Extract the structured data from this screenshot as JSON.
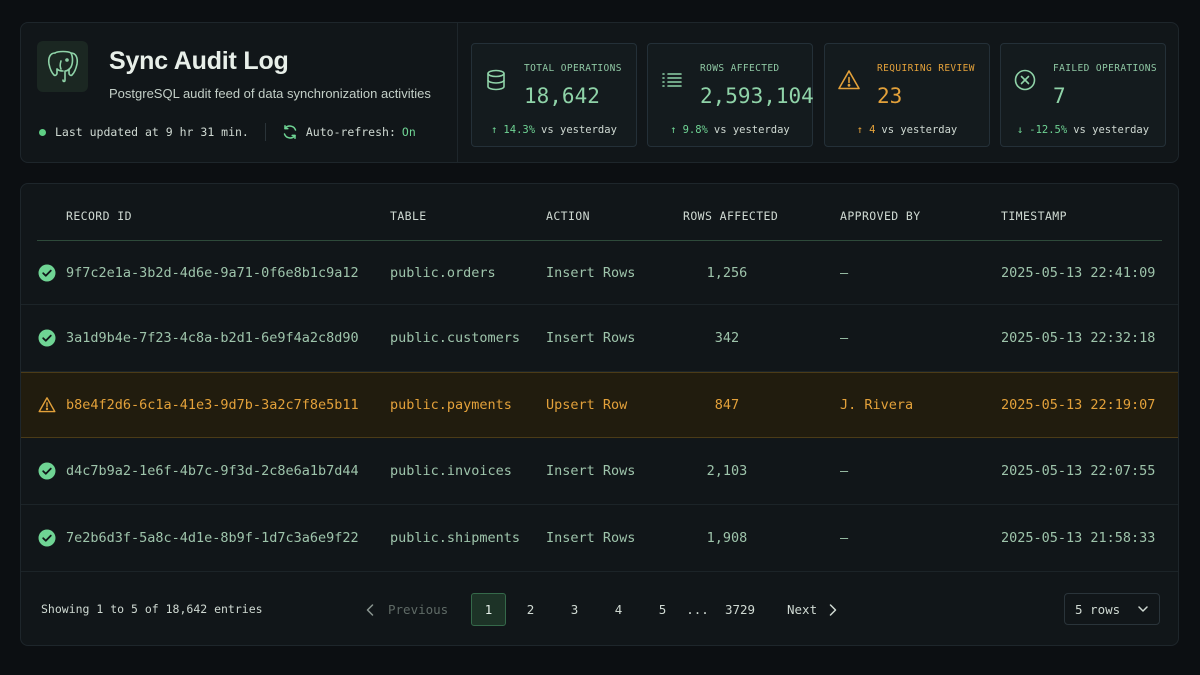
{
  "header": {
    "title": "Sync Audit Log",
    "subtitle": "PostgreSQL audit feed of data synchronization activities",
    "last_updated": "Last updated at 9 hr 31 min.",
    "auto_refresh_label": "Auto-refresh:",
    "auto_refresh_value": "On",
    "logo_icon": "postgresql-elephant-icon"
  },
  "stats": [
    {
      "label": "TOTAL OPERATIONS",
      "value": "18,642",
      "delta": "14.3%",
      "delta_suffix": "vs yesterday",
      "direction": "up",
      "icon": "database-icon"
    },
    {
      "label": "ROWS AFFECTED",
      "value": "2,593,104",
      "delta": "9.8%",
      "delta_suffix": "vs yesterday",
      "direction": "up",
      "icon": "list-icon"
    },
    {
      "label": "REQUIRING REVIEW",
      "value": "23",
      "delta": "4",
      "delta_suffix": "vs yesterday",
      "direction": "up",
      "icon": "warning-icon"
    },
    {
      "label": "FAILED OPERATIONS",
      "value": "7",
      "delta": "-12.5%",
      "delta_suffix": "vs yesterday",
      "direction": "down",
      "icon": "x-circle-icon"
    }
  ],
  "table": {
    "columns": [
      "RECORD ID",
      "TABLE",
      "ACTION",
      "ROWS AFFECTED",
      "APPROVED BY",
      "TIMESTAMP"
    ],
    "rows": [
      {
        "status": "success",
        "id": "9f7c2e1a-3b2d-4d6e-9a71-0f6e8b1c9a12",
        "table": "public.orders",
        "action": "Insert Rows",
        "rows": "1,256",
        "approved_by": "—",
        "timestamp": "2025-05-13 22:41:09"
      },
      {
        "status": "success",
        "id": "3a1d9b4e-7f23-4c8a-b2d1-6e9f4a2c8d90",
        "table": "public.customers",
        "action": "Insert Rows",
        "rows": "342",
        "approved_by": "—",
        "timestamp": "2025-05-13 22:32:18"
      },
      {
        "status": "warning",
        "id": "b8e4f2d6-6c1a-41e3-9d7b-3a2c7f8e5b11",
        "table": "public.payments",
        "action": "Upsert Row",
        "rows": "847",
        "approved_by": "J. Rivera",
        "timestamp": "2025-05-13 22:19:07"
      },
      {
        "status": "success",
        "id": "d4c7b9a2-1e6f-4b7c-9f3d-2c8e6a1b7d44",
        "table": "public.invoices",
        "action": "Insert Rows",
        "rows": "2,103",
        "approved_by": "—",
        "timestamp": "2025-05-13 22:07:55"
      },
      {
        "status": "success",
        "id": "7e2b6d3f-5a8c-4d1e-8b9f-1d7c3a6e9f22",
        "table": "public.shipments",
        "action": "Insert Rows",
        "rows": "1,908",
        "approved_by": "—",
        "timestamp": "2025-05-13 21:58:33"
      }
    ]
  },
  "footer": {
    "showing": "Showing 1 to 5 of 18,642 entries",
    "previous": "Previous",
    "next": "Next",
    "pages": [
      "1",
      "2",
      "3",
      "4",
      "5",
      "...",
      "3729"
    ],
    "current_page": "1",
    "rows_select": "5 rows"
  },
  "colors": {
    "accent": "#6fd494",
    "warning": "#e3a13a",
    "background": "#0c0f12"
  }
}
